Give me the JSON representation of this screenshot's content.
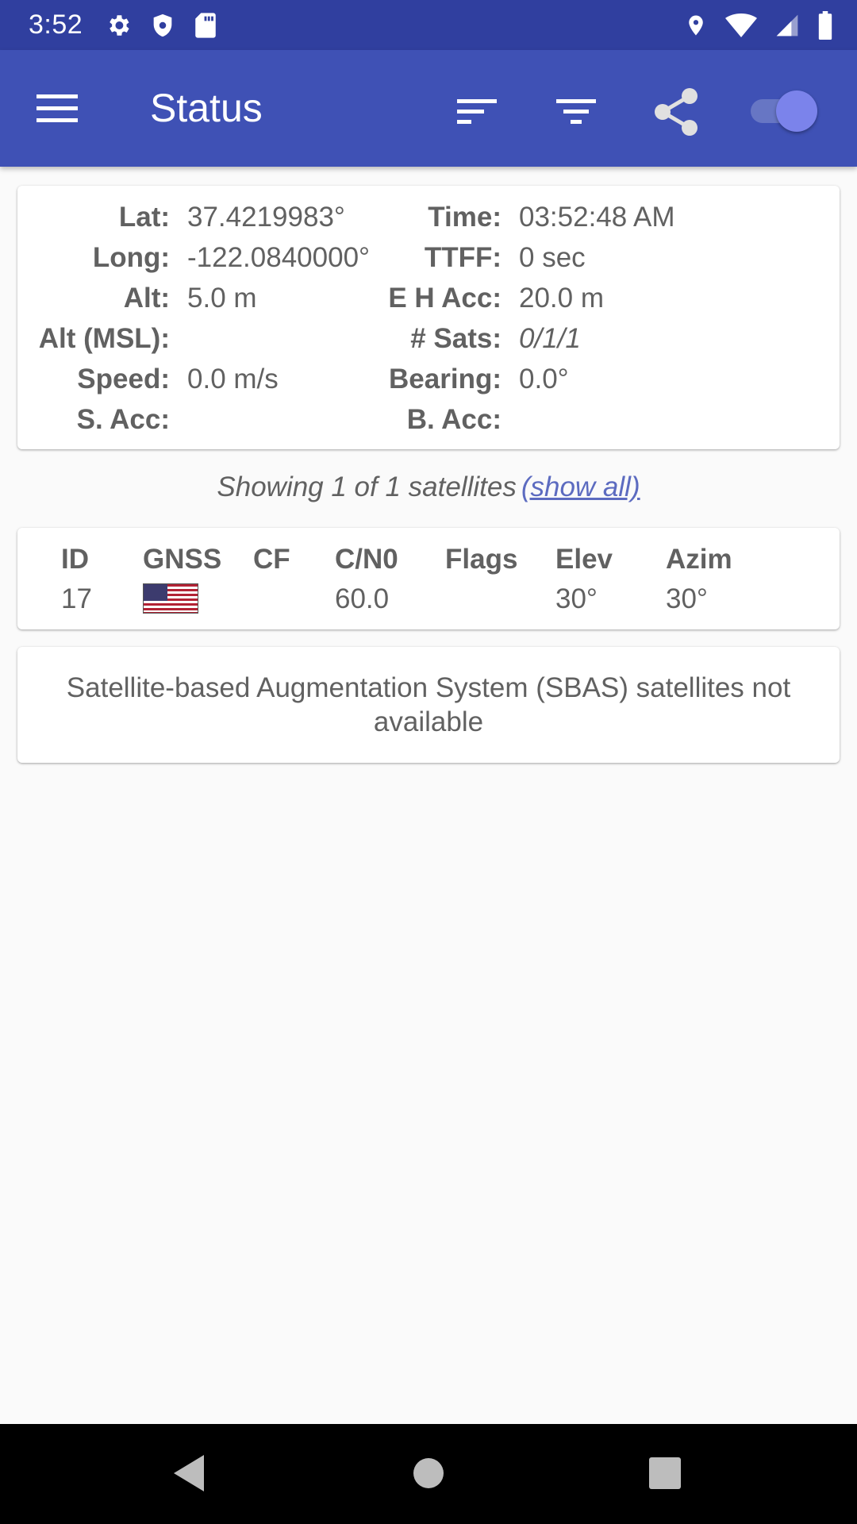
{
  "status_bar": {
    "time": "3:52",
    "left_icons": [
      "gear-icon",
      "shield-icon",
      "sd-card-icon"
    ],
    "right_icons": [
      "location-pin-icon",
      "wifi-icon",
      "cell-signal-icon",
      "battery-icon"
    ]
  },
  "app_bar": {
    "title": "Status",
    "actions": [
      "sort-icon",
      "filter-icon",
      "share-icon"
    ],
    "toggle_on": true
  },
  "location": {
    "left": [
      {
        "label": "Lat:",
        "value": "37.4219983°"
      },
      {
        "label": "Long:",
        "value": "-122.0840000°"
      },
      {
        "label": "Alt:",
        "value": "5.0 m"
      },
      {
        "label": "Alt (MSL):",
        "value": ""
      },
      {
        "label": "Speed:",
        "value": "0.0 m/s"
      },
      {
        "label": "S. Acc:",
        "value": ""
      }
    ],
    "right": [
      {
        "label": "Time:",
        "value": "03:52:48 AM"
      },
      {
        "label": "TTFF:",
        "value": "0 sec"
      },
      {
        "label": "E H Acc:",
        "value": "20.0 m"
      },
      {
        "label": "# Sats:",
        "value": "0/1/1"
      },
      {
        "label": "Bearing:",
        "value": "0.0°"
      },
      {
        "label": "B. Acc:",
        "value": ""
      }
    ]
  },
  "showing": {
    "text": "Showing 1 of 1 satellites",
    "link": "(show all)"
  },
  "satellites": {
    "headers": [
      "ID",
      "GNSS",
      "CF",
      "C/N0",
      "Flags",
      "Elev",
      "Azim"
    ],
    "rows": [
      {
        "id": "17",
        "gnss": "us-flag-icon",
        "cf": "",
        "cn0": "60.0",
        "flags": "",
        "elev": "30°",
        "azim": "30°"
      }
    ]
  },
  "sbas": {
    "message": "Satellite-based Augmentation System (SBAS) satellites not available"
  },
  "colors": {
    "status_bar": "#303f9f",
    "app_bar": "#3f51b5",
    "accent": "#5c6bc0",
    "text": "#616161"
  },
  "nav_bar": {
    "buttons": [
      "back-icon",
      "home-icon",
      "recents-icon"
    ]
  }
}
